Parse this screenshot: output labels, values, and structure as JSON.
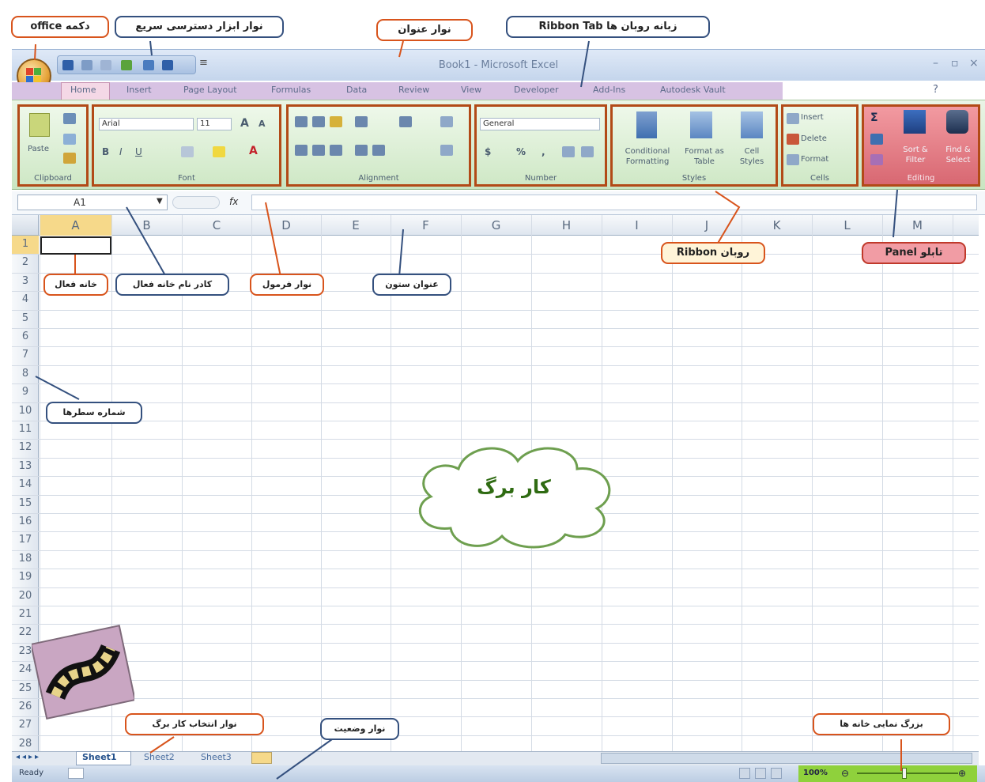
{
  "window": {
    "title": "Book1 - Microsoft Excel",
    "qat_extra": "≡"
  },
  "tabs": [
    "Home",
    "Insert",
    "Page Layout",
    "Formulas",
    "Data",
    "Review",
    "View",
    "Developer",
    "Add-Ins",
    "Autodesk Vault"
  ],
  "ribbon": {
    "clipboard": {
      "paste_label": "Paste",
      "group_label": "Clipboard"
    },
    "font": {
      "font_name": "Arial",
      "font_size": "11",
      "grow": "A",
      "shrink": "A",
      "bold": "B",
      "italic": "I",
      "underline": "U",
      "font_color": "A",
      "group_label": "Font"
    },
    "alignment": {
      "group_label": "Alignment"
    },
    "number": {
      "format": "General",
      "currency": "$",
      "percent": "%",
      "comma": ",",
      "group_label": "Number"
    },
    "styles": {
      "conditional": "Conditional Formatting",
      "format_table": "Format as Table",
      "cell_styles": "Cell Styles",
      "group_label": "Styles"
    },
    "cells": {
      "insert": "Insert",
      "delete": "Delete",
      "format": "Format",
      "group_label": "Cells"
    },
    "editing": {
      "sum": "Σ",
      "sort": "Sort & Filter",
      "find": "Find & Select",
      "group_label": "Editing"
    }
  },
  "formula_bar": {
    "name_box": "A1",
    "fx": "fx",
    "value": ""
  },
  "columns": [
    "A",
    "B",
    "C",
    "D",
    "E",
    "F",
    "G",
    "H",
    "I",
    "J",
    "K",
    "L",
    "M"
  ],
  "rows": [
    "1",
    "2",
    "3",
    "4",
    "5",
    "6",
    "7",
    "8",
    "9",
    "10",
    "11",
    "12",
    "13",
    "14",
    "15",
    "16",
    "17",
    "18",
    "19",
    "20",
    "21",
    "22",
    "23",
    "24",
    "25",
    "26",
    "27",
    "28"
  ],
  "sheets": [
    "Sheet1",
    "Sheet2",
    "Sheet3"
  ],
  "status": {
    "ready": "Ready",
    "zoom": "100%"
  },
  "callouts": {
    "office_button": "دکمه office",
    "quick_access": "نوار ابزار دسترسی سریع",
    "title_bar": "نوار عنوان",
    "ribbon_tab": "زبانه روبان ها Ribbon Tab",
    "ribbon": "روبان Ribbon",
    "panel": "تابلو Panel",
    "active_cell": "خانه فعال",
    "name_box": "کادر نام خانه فعال",
    "formula_bar": "نوار فرمول",
    "column_header": "عنوان ستون",
    "row_numbers": "شماره سطرها",
    "worksheet": "کار برگ",
    "sheet_select": "نوار انتخاب کار برگ",
    "status_bar": "نوار وضعیت",
    "zoom": "بزرگ نمایی خانه ها"
  },
  "colors": {
    "callout_orange": "#d8541c",
    "callout_blue": "#34507e",
    "callout_green": "#6e9f4f",
    "panel_red": "#f19ca4",
    "ribbon_green": "#cfe8c6"
  }
}
